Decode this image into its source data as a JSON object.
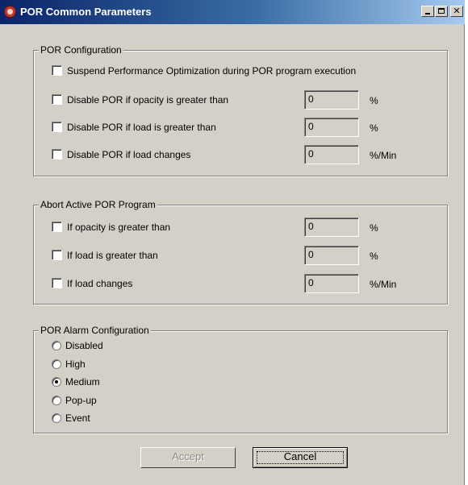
{
  "window": {
    "title": "POR Common Parameters"
  },
  "por_configuration": {
    "title": "POR Configuration",
    "suspend_label": "Suspend Performance Optimization during POR program execution",
    "items": [
      {
        "label": "Disable POR if opacity is greater than",
        "value": "0",
        "unit": "%",
        "checked": false
      },
      {
        "label": "Disable POR if load is greater than",
        "value": "0",
        "unit": "%",
        "checked": false
      },
      {
        "label": "Disable POR if load changes",
        "value": "0",
        "unit": "%/Min",
        "checked": false
      }
    ]
  },
  "abort_program": {
    "title": "Abort Active POR Program",
    "items": [
      {
        "label": "If opacity is greater than",
        "value": "0",
        "unit": "%",
        "checked": false
      },
      {
        "label": "If load is greater than",
        "value": "0",
        "unit": "%",
        "checked": false
      },
      {
        "label": "If load changes",
        "value": "0",
        "unit": "%/Min",
        "checked": false
      }
    ]
  },
  "alarm_configuration": {
    "title": "POR Alarm Configuration",
    "options": [
      {
        "label": "Disabled",
        "selected": false
      },
      {
        "label": "High",
        "selected": false
      },
      {
        "label": "Medium",
        "selected": true
      },
      {
        "label": "Pop-up",
        "selected": false
      },
      {
        "label": "Event",
        "selected": false
      }
    ]
  },
  "buttons": {
    "accept": "Accept",
    "cancel": "Cancel"
  }
}
